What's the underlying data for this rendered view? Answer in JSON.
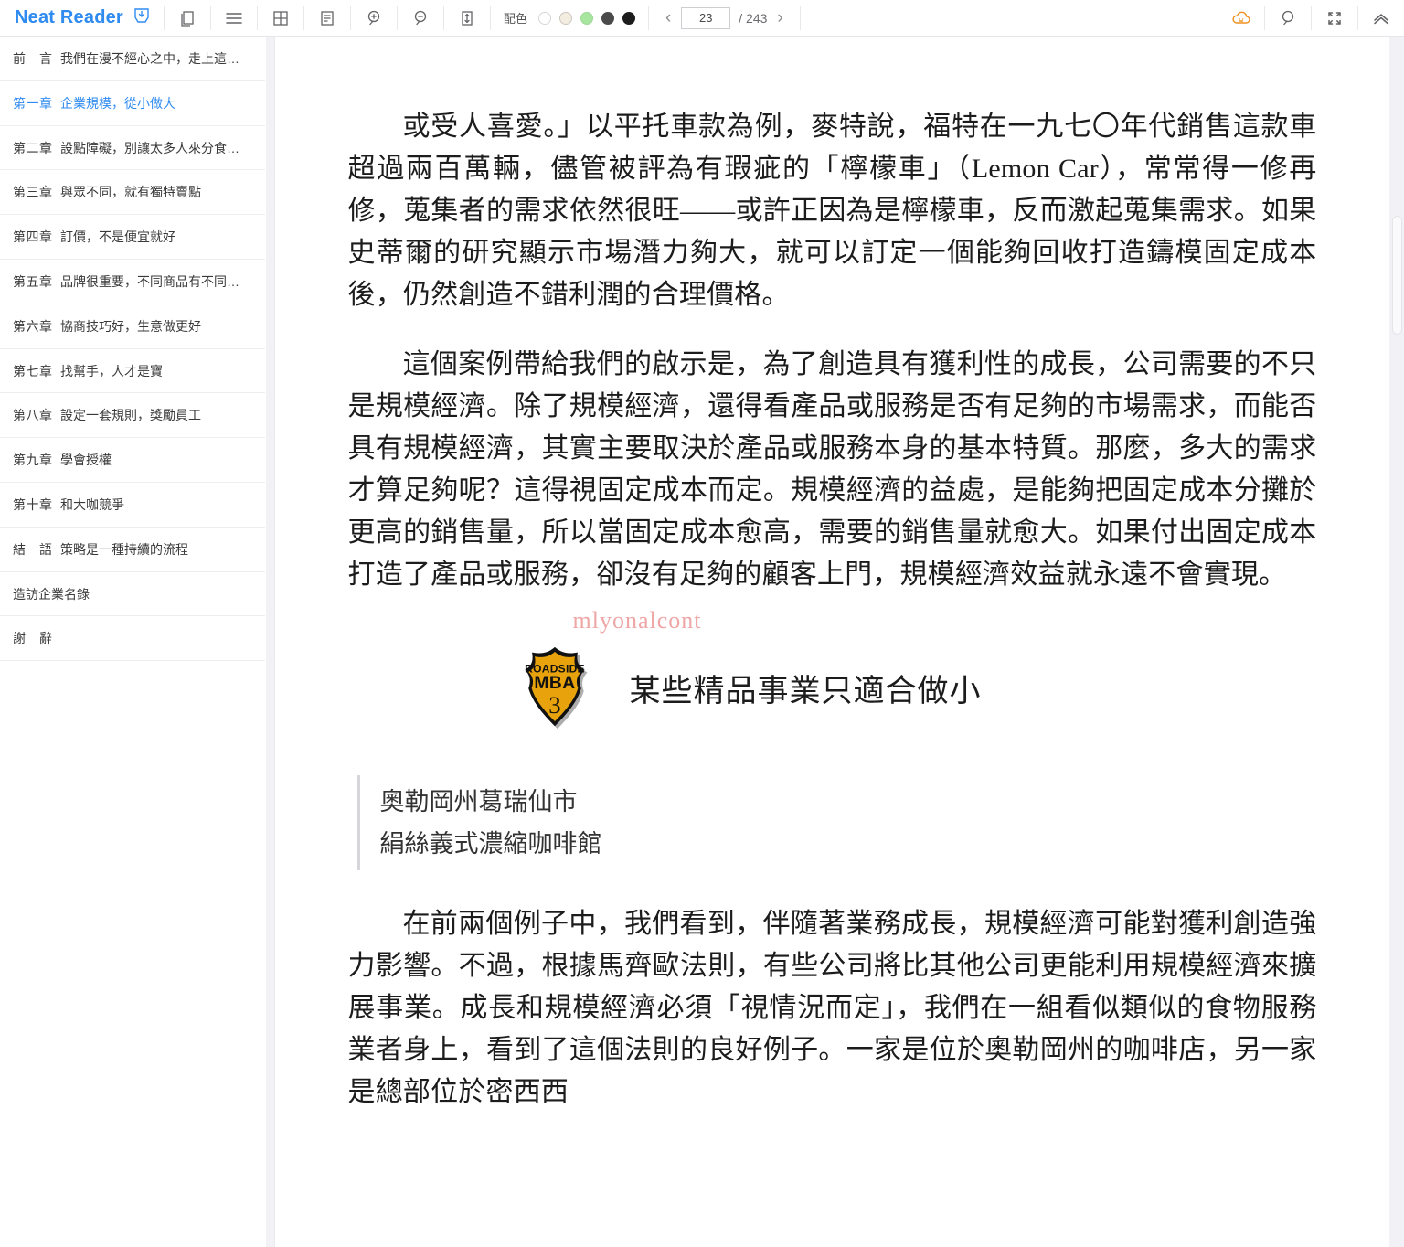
{
  "app": {
    "brand": "Neat Reader"
  },
  "toolbar": {
    "icons": [
      {
        "name": "save-book-icon",
        "label": "save"
      },
      {
        "name": "library-icon",
        "label": "library"
      },
      {
        "name": "contents-list-icon",
        "label": "contents"
      },
      {
        "name": "grid-layout-icon",
        "label": "layout"
      },
      {
        "name": "notes-icon",
        "label": "notes"
      },
      {
        "name": "zoom-in-icon",
        "label": "zoom in"
      },
      {
        "name": "zoom-out-icon",
        "label": "zoom out"
      },
      {
        "name": "line-spacing-icon",
        "label": "line spacing"
      }
    ],
    "color_scheme": {
      "label": "配色",
      "swatches": [
        "#ffffff",
        "#f3ece0",
        "#a8e6a0",
        "#4a4a4a",
        "#1c1c1c"
      ],
      "selected_index": 0
    },
    "pager": {
      "prev": "‹",
      "next": "›",
      "current_page": "23",
      "total_label": "/ 243"
    },
    "right_icons": [
      {
        "name": "cloud-sync-icon",
        "label": "cloud",
        "color": "#f09022"
      },
      {
        "name": "search-icon",
        "label": "search"
      },
      {
        "name": "fullscreen-icon",
        "label": "fullscreen"
      },
      {
        "name": "collapse-up-icon",
        "label": "collapse"
      }
    ]
  },
  "sidebar": {
    "toc": [
      {
        "num": "前　言",
        "title": "我們在漫不經心之中，走上這…",
        "active": false
      },
      {
        "num": "第一章",
        "title": "企業規模，從小做大",
        "active": true
      },
      {
        "num": "第二章",
        "title": "設點障礙，別讓太多人來分食…",
        "active": false
      },
      {
        "num": "第三章",
        "title": "與眾不同，就有獨特賣點",
        "active": false
      },
      {
        "num": "第四章",
        "title": "訂價，不是便宜就好",
        "active": false
      },
      {
        "num": "第五章",
        "title": "品牌很重要，不同商品有不同…",
        "active": false
      },
      {
        "num": "第六章",
        "title": "協商技巧好，生意做更好",
        "active": false
      },
      {
        "num": "第七章",
        "title": "找幫手，人才是寶",
        "active": false
      },
      {
        "num": "第八章",
        "title": "設定一套規則，獎勵員工",
        "active": false
      },
      {
        "num": "第九章",
        "title": "學會授權",
        "active": false
      },
      {
        "num": "第十章",
        "title": "和大咖競爭",
        "active": false
      },
      {
        "num": "結　語",
        "title": "策略是一種持續的流程",
        "active": false
      },
      {
        "num": "",
        "title": "造訪企業名錄",
        "active": false
      },
      {
        "num": "謝　辭",
        "title": "",
        "active": false
      }
    ],
    "active_color": "#2f8bf0"
  },
  "content": {
    "paragraph_1": "或受人喜愛。」以平托車款為例，麥特說，福特在一九七〇年代銷售這款車超過兩百萬輛，儘管被評為有瑕疵的「檸檬車」（Lemon Car），常常得一修再修，蒐集者的需求依然很旺——或許正因為是檸檬車，反而激起蒐集需求。如果史蒂爾的研究顯示市場潛力夠大，就可以訂定一個能夠回收打造鑄模固定成本後，仍然創造不錯利潤的合理價格。",
    "paragraph_2": "這個案例帶給我們的啟示是，為了創造具有獲利性的成長，公司需要的不只是規模經濟。除了規模經濟，還得看產品或服務是否有足夠的市場需求，而能否具有規模經濟，其實主要取決於產品或服務本身的基本特質。那麼，多大的需求才算足夠呢？這得視固定成本而定。規模經濟的益處，是能夠把固定成本分攤於更高的銷售量，所以當固定成本愈高，需要的銷售量就愈大。如果付出固定成本打造了產品或服務，卻沒有足夠的顧客上門，規模經濟效益就永遠不會實現。",
    "watermark": "mlyonalcont",
    "badge": {
      "line1": "ROADSIDE",
      "line2": "MBA",
      "number": "3",
      "fill": "#e8a30c",
      "text_color": "#111111"
    },
    "section_title": "某些精品事業只適合做小",
    "quote_line1": "奧勒岡州葛瑞仙市",
    "quote_line2": "絹絲義式濃縮咖啡館",
    "paragraph_3": "在前兩個例子中，我們看到，伴隨著業務成長，規模經濟可能對獲利創造強力影響。不過，根據馬齊歐法則，有些公司將比其他公司更能利用規模經濟來擴展事業。成長和規模經濟必須「視情況而定」，我們在一組看似類似的食物服務業者身上，看到了這個法則的良好例子。一家是位於奧勒岡州的咖啡店，另一家是總部位於密西西"
  }
}
